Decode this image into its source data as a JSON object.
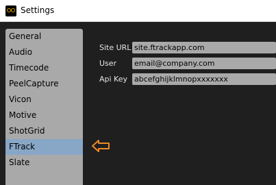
{
  "window": {
    "title": "Settings",
    "icon": "app-logo-icon"
  },
  "sidebar": {
    "items": [
      {
        "label": "General"
      },
      {
        "label": "Audio"
      },
      {
        "label": "Timecode"
      },
      {
        "label": "PeelCapture"
      },
      {
        "label": "Vicon"
      },
      {
        "label": "Motive"
      },
      {
        "label": "ShotGrid"
      },
      {
        "label": "FTrack",
        "selected": true
      },
      {
        "label": "Slate"
      }
    ]
  },
  "annotation": {
    "icon": "left-arrow-icon",
    "color": "#f08a24"
  },
  "form": {
    "site_url": {
      "label": "Site URL",
      "value": "site.ftrackapp.com"
    },
    "user": {
      "label": "User",
      "value": "email@company.com"
    },
    "api_key": {
      "label": "Api Key",
      "value": "abcefghijklmnopxxxxxxx"
    }
  },
  "colors": {
    "background": "#1f1f1f",
    "sidebar": "#a9a9a9",
    "selected": "#88a7c7",
    "accent": "#e0a400"
  }
}
